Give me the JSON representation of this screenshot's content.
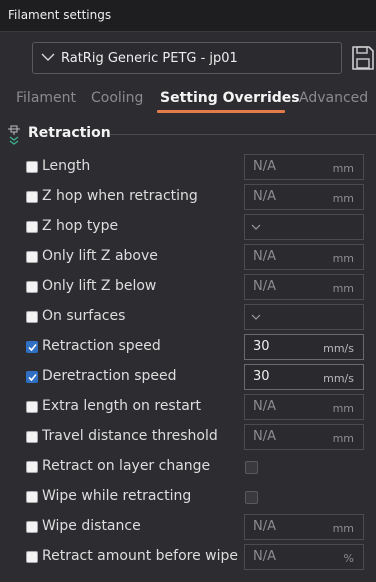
{
  "window": {
    "title": "Filament settings"
  },
  "preset": {
    "name": "RatRig Generic PETG - jp01"
  },
  "tabs": [
    {
      "label": "Filament"
    },
    {
      "label": "Cooling"
    },
    {
      "label": "Setting Overrides"
    },
    {
      "label": "Advanced"
    }
  ],
  "active_tab": "Setting Overrides",
  "section": {
    "title": "Retraction"
  },
  "settings": [
    {
      "label": "Length",
      "checked": false,
      "type": "number",
      "value": "N/A",
      "unit": "mm"
    },
    {
      "label": "Z hop when retracting",
      "checked": false,
      "type": "number",
      "value": "N/A",
      "unit": "mm"
    },
    {
      "label": "Z hop type",
      "checked": false,
      "type": "combo",
      "value": "",
      "unit": ""
    },
    {
      "label": "Only lift Z above",
      "checked": false,
      "type": "number",
      "value": "N/A",
      "unit": "mm"
    },
    {
      "label": "Only lift Z below",
      "checked": false,
      "type": "number",
      "value": "N/A",
      "unit": "mm"
    },
    {
      "label": "On surfaces",
      "checked": false,
      "type": "combo",
      "value": "",
      "unit": ""
    },
    {
      "label": "Retraction speed",
      "checked": true,
      "type": "number",
      "value": "30",
      "unit": "mm/s"
    },
    {
      "label": "Deretraction speed",
      "checked": true,
      "type": "number",
      "value": "30",
      "unit": "mm/s"
    },
    {
      "label": "Extra length on restart",
      "checked": false,
      "type": "number",
      "value": "N/A",
      "unit": "mm"
    },
    {
      "label": "Travel distance threshold",
      "checked": false,
      "type": "number",
      "value": "N/A",
      "unit": "mm"
    },
    {
      "label": "Retract on layer change",
      "checked": false,
      "type": "bool",
      "value": "",
      "unit": ""
    },
    {
      "label": "Wipe while retracting",
      "checked": false,
      "type": "bool",
      "value": "",
      "unit": ""
    },
    {
      "label": "Wipe distance",
      "checked": false,
      "type": "number",
      "value": "N/A",
      "unit": "mm"
    },
    {
      "label": "Retract amount before wipe",
      "checked": false,
      "type": "number",
      "value": "N/A",
      "unit": "%"
    }
  ],
  "colors": {
    "accent": "#e27b4a",
    "checkbox_checked": "#2f6fc4",
    "background": "#2d2d31"
  }
}
